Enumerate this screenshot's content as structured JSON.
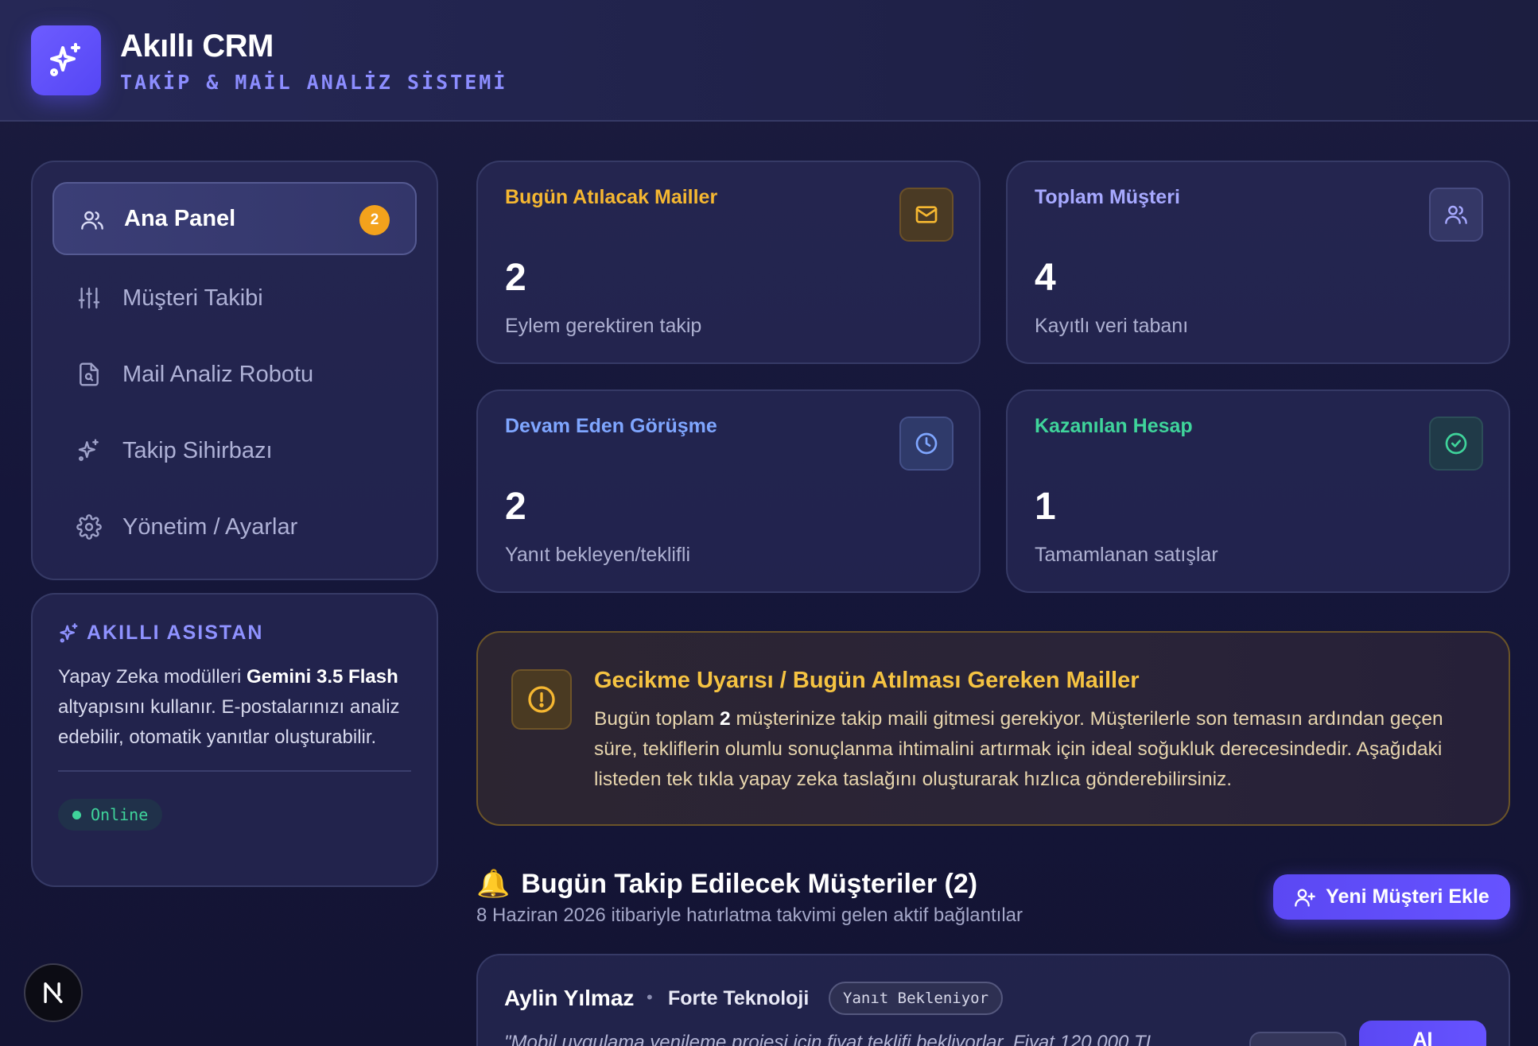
{
  "brand": {
    "title": "Akıllı CRM",
    "subtitle": "TAKİP & MAİL ANALİZ SİSTEMİ"
  },
  "nav": {
    "items": [
      {
        "label": "Ana Panel",
        "icon": "users-icon",
        "badge": "2",
        "active": true
      },
      {
        "label": "Müşteri Takibi",
        "icon": "sliders-icon"
      },
      {
        "label": "Mail Analiz Robotu",
        "icon": "file-search-icon"
      },
      {
        "label": "Takip Sihirbazı",
        "icon": "sparkles-icon"
      },
      {
        "label": "Yönetim / Ayarlar",
        "icon": "gear-icon"
      }
    ]
  },
  "assistant": {
    "title": "AKILLI ASISTAN",
    "text_1": "Yapay Zeka modülleri ",
    "text_bold": "Gemini 3.5 Flash",
    "text_2": " altyapısını kullanır. E-postalarınızı analiz edebilir, otomatik yanıtlar oluşturabilir.",
    "status": "Online"
  },
  "stats": [
    {
      "title": "Bugün Atılacak Mailler",
      "value": "2",
      "desc": "Eylem gerektiren takip",
      "color": "#f5b731",
      "icon": "mail-icon"
    },
    {
      "title": "Toplam Müşteri",
      "value": "4",
      "desc": "Kayıtlı veri tabanı",
      "color": "#a7a9ff",
      "icon": "users-icon"
    },
    {
      "title": "Devam Eden Görüşme",
      "value": "2",
      "desc": "Yanıt bekleyen/teklifli",
      "color": "#7fa6ff",
      "icon": "clock-icon"
    },
    {
      "title": "Kazanılan Hesap",
      "value": "1",
      "desc": "Tamamlanan satışlar",
      "color": "#3fd49b",
      "icon": "check-circle-icon"
    }
  ],
  "alert": {
    "title": "Gecikme Uyarısı / Bugün Atılması Gereken Mailler",
    "text_1": "Bugün toplam ",
    "text_bold": "2",
    "text_2": " müşterinize takip maili gitmesi gerekiyor. Müşterilerle son temasın ardından geçen süre, tekliflerin olumlu sonuçlanma ihtimalini artırmak için ideal soğukluk derecesindedir. Aşağıdaki listeden tek tıkla yapay zeka taslağını oluşturarak hızlıca gönderebilirsiniz."
  },
  "followups": {
    "emoji": "🔔",
    "title": "Bugün Takip Edilecek Müşteriler (2)",
    "subtitle": "8 Haziran 2026 itibariyle hatırlatma takvimi gelen aktif bağlantılar",
    "add_button": "Yeni Müşteri Ekle",
    "customer": {
      "name": "Aylin Yılmaz",
      "separator": "•",
      "company": "Forte Teknoloji",
      "status": "Yanıt Bekleniyor",
      "note": "\"Mobil uygulama yenileme projesi için fiyat teklifi bekliyorlar. Fiyat 120.000 TL",
      "action_label": "AI"
    }
  }
}
